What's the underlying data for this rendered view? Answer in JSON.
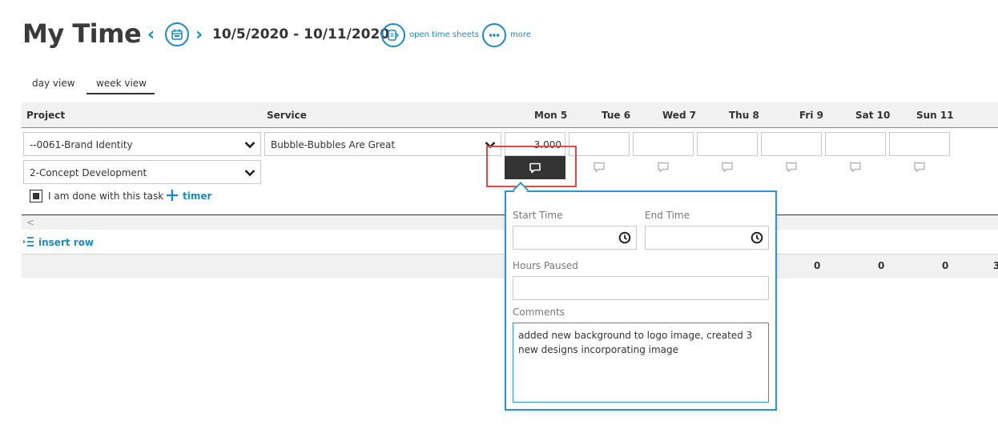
{
  "header": {
    "title": "My Time",
    "date_range": "10/5/2020 - 10/11/2020",
    "open_time_sheets": "open time sheets",
    "more": "more",
    "prev_glyph": "‹",
    "next_glyph": "›"
  },
  "tabs": [
    {
      "label": "day view",
      "selected": false
    },
    {
      "label": "week view",
      "selected": true
    }
  ],
  "columns": {
    "project": "Project",
    "service": "Service",
    "days": [
      "Mon 5",
      "Tue 6",
      "Wed 7",
      "Thu 8",
      "Fri 9",
      "Sat 10",
      "Sun 11"
    ]
  },
  "row": {
    "project": "--0061-Brand Identity",
    "service": "Bubble-Bubbles Are Great",
    "task": "2-Concept Development",
    "hours": [
      "3.000",
      "",
      "",
      "",
      "",
      "",
      ""
    ],
    "done_label": "I am done with this task",
    "done_checked": true,
    "timer_label": "timer"
  },
  "insert_row": "insert row",
  "totals": [
    "0",
    "0",
    "0",
    "3"
  ],
  "scroll_left_glyph": "<",
  "popover": {
    "start_time_label": "Start Time",
    "start_time": "",
    "end_time_label": "End Time",
    "end_time": "",
    "hours_paused_label": "Hours Paused",
    "hours_paused": "",
    "comments_label": "Comments",
    "comments": "added new background to logo image, created 3 new designs incorporating image"
  },
  "colors": {
    "accent": "#1b8ac9",
    "popover_border": "#2a96d0",
    "highlight": "#e04848",
    "active_comment_bg": "#333333"
  },
  "icons": {
    "calendar": "calendar-icon",
    "timesheet": "timesheet-icon",
    "more": "more-icon",
    "comment": "comment-icon",
    "clock": "clock-icon",
    "chevron": "chevron-down-icon",
    "plus": "plus-icon",
    "insert": "insert-row-icon"
  }
}
